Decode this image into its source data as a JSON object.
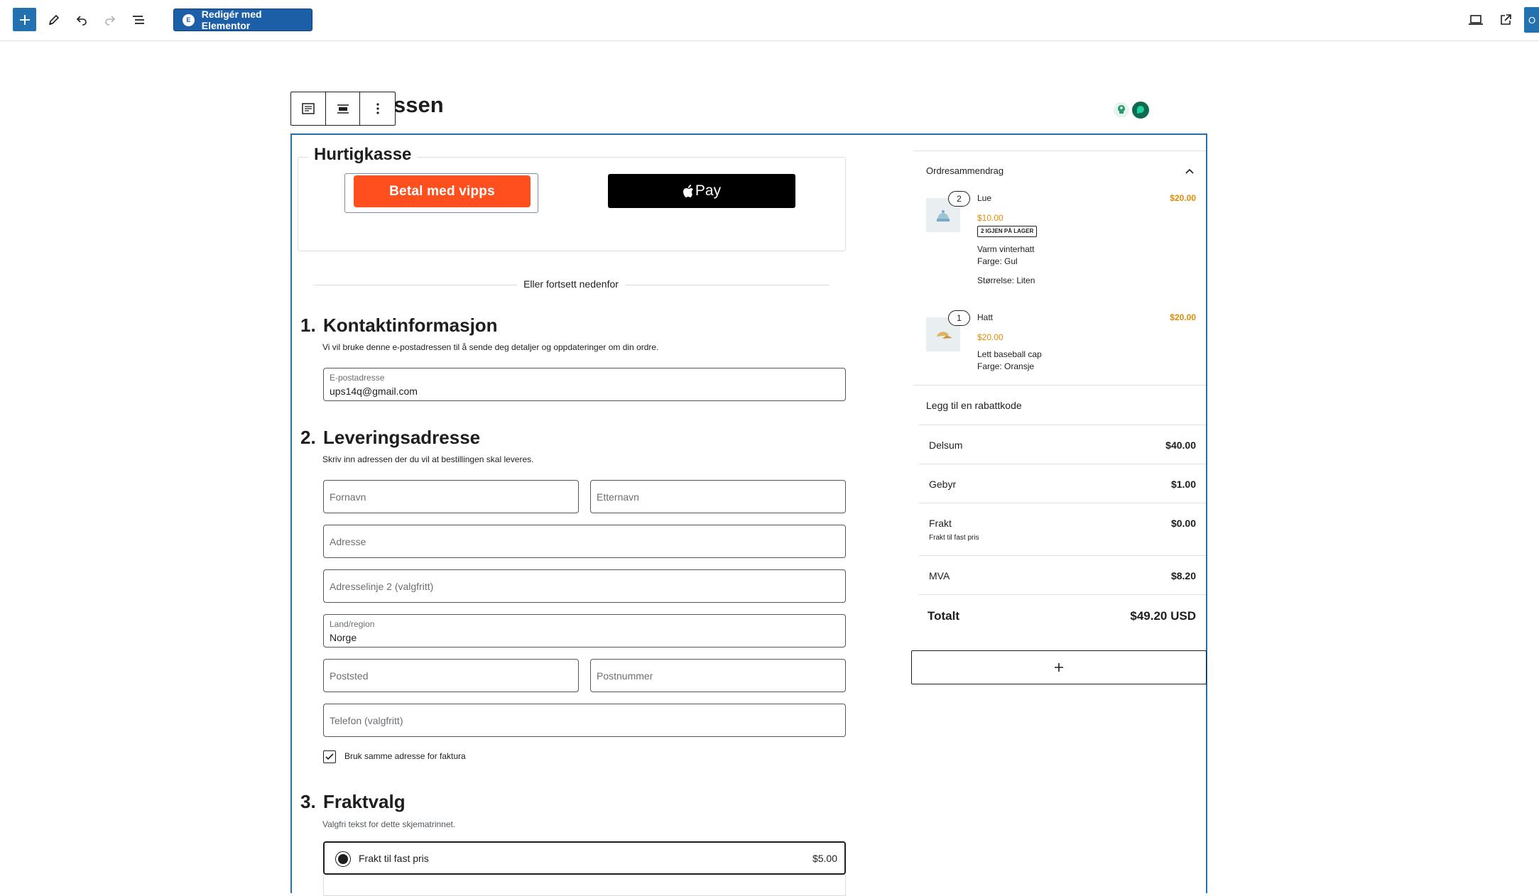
{
  "toolbar": {
    "elementor_label": "Redigér med Elementor",
    "elementor_badge": "E",
    "publish_edge_label": "O"
  },
  "page": {
    "title_partial": "ssen"
  },
  "express": {
    "title": "Hurtigkasse",
    "vipps_label": "Betal med vipps",
    "applepay_label": "Pay",
    "divider_text": "Eller fortsett nedenfor"
  },
  "contact": {
    "number": "1.",
    "heading": "Kontaktinformasjon",
    "description": "Vi vil bruke denne e-postadressen til å sende deg detaljer og oppdateringer om din ordre.",
    "email_label": "E-postadresse",
    "email_value": "ups14q@gmail.com"
  },
  "shipping_address": {
    "number": "2.",
    "heading": "Leveringsadresse",
    "description": "Skriv inn adressen der du vil at bestillingen skal leveres.",
    "first_name_ph": "Fornavn",
    "last_name_ph": "Etternavn",
    "address_ph": "Adresse",
    "address2_ph": "Adresselinje 2 (valgfritt)",
    "country_label": "Land/region",
    "country_value": "Norge",
    "city_ph": "Poststed",
    "postcode_ph": "Postnummer",
    "phone_ph": "Telefon (valgfritt)",
    "same_billing_label": "Bruk samme adresse for faktura"
  },
  "shipping_options": {
    "number": "3.",
    "heading": "Fraktvalg",
    "description": "Valgfri tekst for dette skjematrinnet.",
    "option_label": "Frakt til fast pris",
    "option_price": "$5.00"
  },
  "summary": {
    "title": "Ordresammendrag",
    "items": [
      {
        "qty": "2",
        "name": "Lue",
        "unit_price": "$10.00",
        "total": "$20.00",
        "stock": "2 IGJEN PÅ LAGER",
        "description": "Varm vinterhatt",
        "meta1": "Farge: Gul",
        "meta2": "Størrelse: Liten"
      },
      {
        "qty": "1",
        "name": "Hatt",
        "unit_price": "$20.00",
        "total": "$20.00",
        "description": "Lett baseball cap",
        "meta1": "Farge: Oransje"
      }
    ],
    "coupon_label": "Legg til en rabattkode",
    "subtotal_label": "Delsum",
    "subtotal_value": "$40.00",
    "fee_label": "Gebyr",
    "fee_value": "$1.00",
    "shipping_label": "Frakt",
    "shipping_value": "$0.00",
    "shipping_sub": "Frakt til fast pris",
    "tax_label": "MVA",
    "tax_value": "$8.20",
    "total_label": "Totalt",
    "total_value": "$49.20 USD"
  },
  "icons": {
    "add": "plus-icon",
    "tools": "pencil-icon",
    "undo": "undo-icon",
    "redo": "redo-icon",
    "list_view": "list-view-icon",
    "preview": "laptop-icon",
    "view_post": "external-link-icon"
  },
  "colors": {
    "accent": "#2271b1",
    "elementor": "#1d5fa7",
    "vipps": "#ff4f1f",
    "price": "#e28b00"
  }
}
